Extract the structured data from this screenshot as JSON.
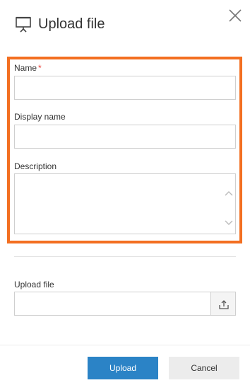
{
  "dialog": {
    "title": "Upload file",
    "title_icon": "presentation-icon",
    "close_icon": "close-icon"
  },
  "form": {
    "name_label": "Name",
    "required_marker": "*",
    "display_name_label": "Display name",
    "description_label": "Description",
    "name_value": "",
    "display_name_value": "",
    "description_value": ""
  },
  "upload": {
    "label": "Upload file",
    "value": "",
    "icon": "upload-icon"
  },
  "footer": {
    "upload_label": "Upload",
    "cancel_label": "Cancel"
  },
  "colors": {
    "highlight": "#f36f21",
    "primary": "#2b83c6",
    "required": "#e8453c"
  }
}
